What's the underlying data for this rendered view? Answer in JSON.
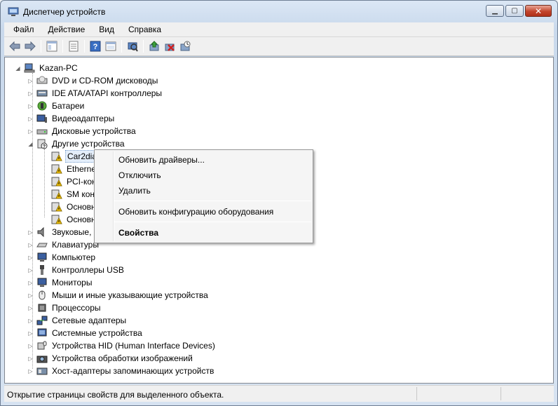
{
  "window": {
    "title": "Диспетчер устройств"
  },
  "menu": [
    "Файл",
    "Действие",
    "Вид",
    "Справка"
  ],
  "toolbar": {
    "icons": [
      "back-arrow-icon",
      "forward-arrow-icon",
      "show-hide-tree-icon",
      "properties-icon",
      "help-icon",
      "view-icon",
      "scan-hardware-icon",
      "update-driver-icon",
      "uninstall-icon",
      "disable-icon"
    ]
  },
  "tree": {
    "root": "Kazan-PC",
    "categories": [
      "DVD и CD-ROM дисководы",
      "IDE ATA/ATAPI контроллеры",
      "Батареи",
      "Видеоадаптеры",
      "Дисковые устройства",
      "Другие устройства",
      "Звуковые, ",
      "Клавиатуры",
      "Компьютер",
      "Контроллеры USB",
      "Мониторы",
      "Мыши и иные указывающие устройства",
      "Процессоры",
      "Сетевые адаптеры",
      "Системные устройства",
      "Устройства HID (Human Interface Devices)",
      "Устройства обработки изображений",
      "Хост-адаптеры запоминающих устройств"
    ],
    "other_devices": [
      "Car2dia",
      "Etherne",
      "PCI-кон",
      "SM конт",
      "Основн",
      "Основн"
    ]
  },
  "context_menu": {
    "update_drivers": "Обновить драйверы...",
    "disable": "Отключить",
    "uninstall": "Удалить",
    "scan": "Обновить конфигурацию оборудования",
    "properties": "Свойства"
  },
  "status": {
    "text": "Открытие страницы свойств для выделенного объекта."
  }
}
